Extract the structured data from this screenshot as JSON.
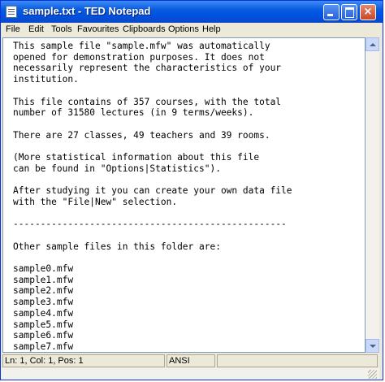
{
  "window": {
    "title": "sample.txt - TED Notepad"
  },
  "titlebar_buttons": {
    "close_glyph": "×"
  },
  "menu": [
    "File",
    "Edit",
    "Tools",
    "Favourites",
    "Clipboards",
    "Options",
    "Help"
  ],
  "editor": {
    "text": "This sample file \"sample.mfw\" was automatically\nopened for demonstration purposes. It does not\nnecessarily represent the characteristics of your\ninstitution.\n\nThis file contains of 357 courses, with the total\nnumber of 31580 lectures (in 9 terms/weeks).\n\nThere are 27 classes, 49 teachers and 39 rooms.\n\n(More statistical information about this file\ncan be found in \"Options|Statistics\").\n\nAfter studying it you can create your own data file\nwith the \"File|New\" selection.\n\n--------------------------------------------------\n\nOther sample files in this folder are:\n\nsample0.mfw\nsample1.mfw\nsample2.mfw\nsample3.mfw\nsample4.mfw\nsample5.mfw\nsample6.mfw\nsample7.mfw"
  },
  "status": {
    "position": "Ln: 1, Col: 1, Pos: 1",
    "encoding": "ANSI"
  },
  "colors": {
    "titlebar": "#0054e3",
    "chrome": "#ece9d8",
    "editor_border": "#7f9db9"
  },
  "icons": [
    "notepad-app-icon",
    "minimize-icon",
    "maximize-icon",
    "close-icon",
    "scroll-up-arrow-icon",
    "scroll-down-arrow-icon",
    "resize-grip-icon"
  ]
}
